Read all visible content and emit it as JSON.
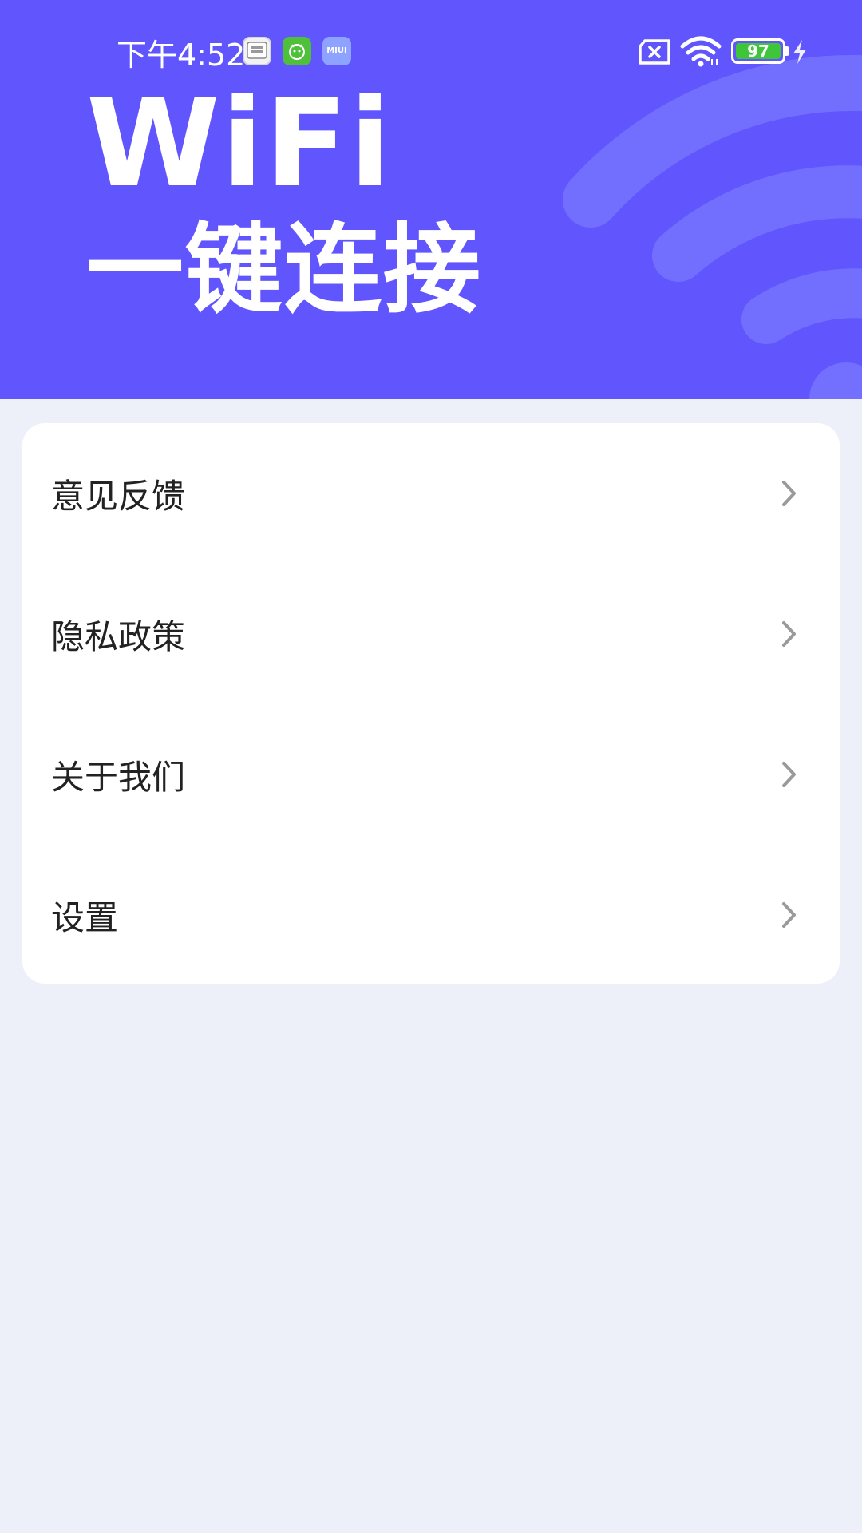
{
  "status_bar": {
    "time": "下午4:52",
    "notifications": [
      "blood-pressure-app-icon",
      "green-robot-app-icon",
      "miui-app-icon"
    ],
    "miui_label": "MIUI",
    "battery_level": "97",
    "battery_fill_color": "#3ec53a",
    "icons": [
      "no-sim-icon",
      "wifi-icon",
      "battery-icon",
      "charging-icon"
    ]
  },
  "banner": {
    "title_line1": "WiFi",
    "title_line2": "一键连接",
    "background_color": "#6155fd",
    "decoration": "wifi-icon"
  },
  "menu": {
    "items": [
      {
        "label": "意见反馈",
        "icon": "chevron-right-icon"
      },
      {
        "label": "隐私政策",
        "icon": "chevron-right-icon"
      },
      {
        "label": "关于我们",
        "icon": "chevron-right-icon"
      },
      {
        "label": "设置",
        "icon": "chevron-right-icon"
      }
    ]
  },
  "colors": {
    "page_background": "#edf0f8",
    "card_background": "#ffffff",
    "text": "#222222",
    "chevron": "#9a9a9a"
  }
}
